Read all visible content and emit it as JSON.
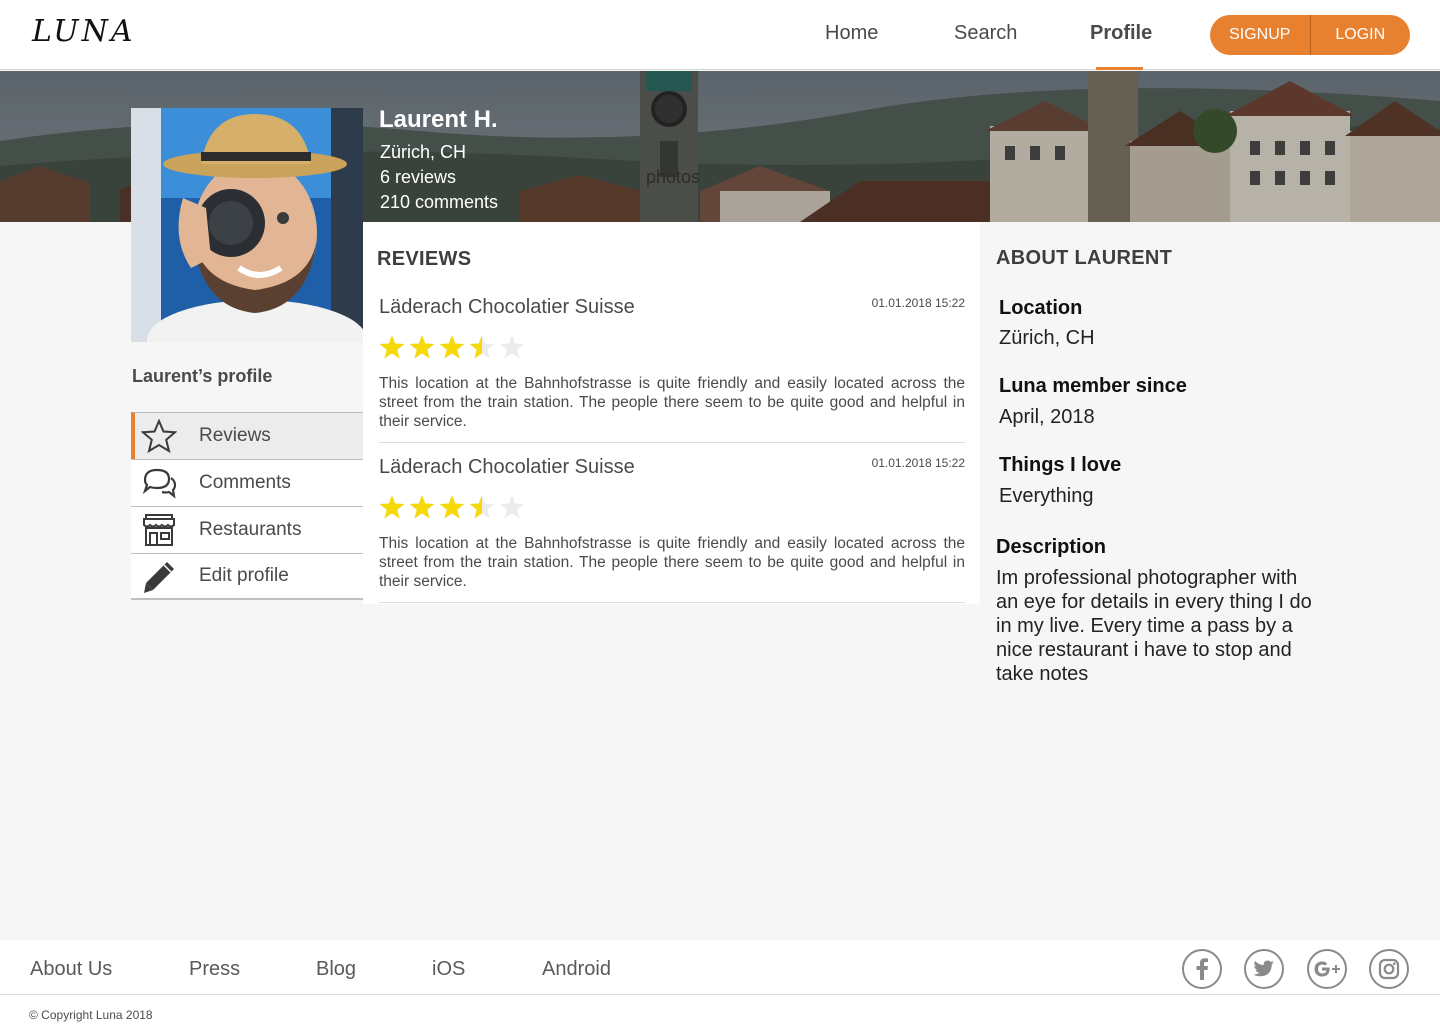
{
  "brand": {
    "logo": "LUNA"
  },
  "nav": {
    "items": [
      "Home",
      "Search",
      "Profile"
    ],
    "active": "Profile",
    "signup": "SIGNUP",
    "login": "LOGIN"
  },
  "user": {
    "name": "Laurent H.",
    "location": "Zürich, CH",
    "reviews_count": "6 reviews",
    "comments_count": "210 comments",
    "photos_label": "photos"
  },
  "sidebar": {
    "title": "Laurent’s profile",
    "items": [
      {
        "label": "Reviews",
        "icon": "star-icon",
        "active": true
      },
      {
        "label": "Comments",
        "icon": "chat-bubbles-icon",
        "active": false
      },
      {
        "label": "Restaurants",
        "icon": "storefront-icon",
        "active": false
      },
      {
        "label": "Edit profile",
        "icon": "pencil-icon",
        "active": false
      }
    ]
  },
  "reviews": {
    "heading": "REVIEWS",
    "items": [
      {
        "title": "Läderach Chocolatier Suisse",
        "date": "01.01.2018 15:22",
        "rating": 3.5,
        "text": "This location at the Bahnhofstrasse is quite friendly and easily located across the street from the train station. The people there seem to be quite good and helpful in their service."
      },
      {
        "title": "Läderach Chocolatier Suisse",
        "date": "01.01.2018 15:22",
        "rating": 3.5,
        "text": "This location at the Bahnhofstrasse is quite friendly and easily located across the street from the train station. The people there seem to be quite good and helpful in their service."
      }
    ]
  },
  "about": {
    "heading": "ABOUT LAURENT",
    "location_label": "Location",
    "location_value": "Zürich, CH",
    "member_label": "Luna member since",
    "member_value": "April, 2018",
    "love_label": "Things I love",
    "love_value": "Everything",
    "description_label": "Description",
    "description_value": "Im professional photographer with an eye for details in every thing I do in my live. Every time a pass by a nice restaurant i have to stop and take notes"
  },
  "footer": {
    "links": [
      "About Us",
      "Press",
      "Blog",
      "iOS",
      "Android"
    ],
    "social": [
      "facebook-icon",
      "twitter-icon",
      "google-plus-icon",
      "instagram-icon"
    ],
    "copyright": "© Copyright Luna 2018"
  },
  "colors": {
    "accent": "#e8812f",
    "star": "#f5d90a",
    "star_empty": "#ececec"
  }
}
